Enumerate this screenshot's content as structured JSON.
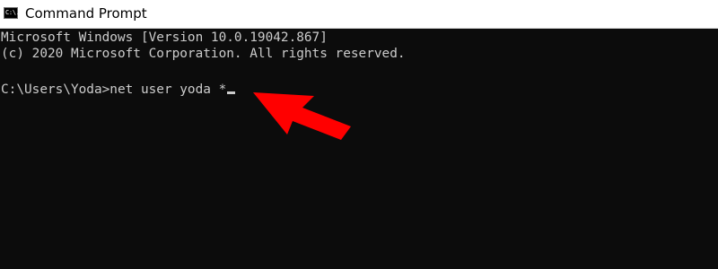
{
  "window": {
    "title": "Command Prompt",
    "icon": "cmd-icon",
    "icon_text": "C:\\."
  },
  "console": {
    "line1": "Microsoft Windows [Version 10.0.19042.867]",
    "line2": "(c) 2020 Microsoft Corporation. All rights reserved.",
    "prompt": "C:\\Users\\Yoda>",
    "command": "net user yoda *"
  },
  "annotation": {
    "icon": "arrow-icon",
    "color": "#ff0000"
  },
  "colors": {
    "console_bg": "#0c0c0c",
    "console_text": "#cccccc",
    "titlebar_bg": "#ffffff"
  }
}
